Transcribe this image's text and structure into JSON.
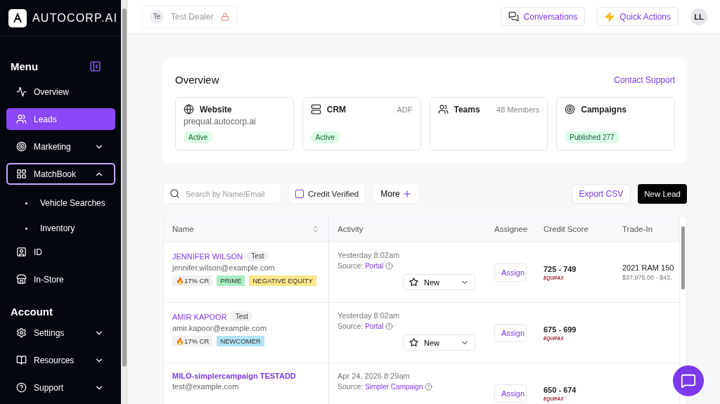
{
  "brand": {
    "name": "AUTOCORP.AI"
  },
  "sidebar": {
    "sections": [
      {
        "title": "Menu",
        "items": [
          {
            "label": "Overview",
            "selected": false,
            "focused": false
          },
          {
            "label": "Leads",
            "selected": true,
            "focused": false
          },
          {
            "label": "Marketing",
            "selected": false,
            "focused": false,
            "expanded": false
          },
          {
            "label": "MatchBook",
            "selected": false,
            "focused": true,
            "expanded": true,
            "children": [
              {
                "label": "Vehicle Searches"
              },
              {
                "label": "Inventory"
              }
            ]
          },
          {
            "label": "ID",
            "selected": false,
            "focused": false
          },
          {
            "label": "In-Store",
            "selected": false,
            "focused": false
          }
        ]
      },
      {
        "title": "Account",
        "items": [
          {
            "label": "Settings",
            "selected": false,
            "focused": false,
            "expanded": false
          },
          {
            "label": "Resources",
            "selected": false,
            "focused": false,
            "expanded": false
          },
          {
            "label": "Support",
            "selected": false,
            "focused": false,
            "expanded": false
          }
        ]
      }
    ]
  },
  "header": {
    "dealer_initials": "Te",
    "dealer": "Test Dealer",
    "locked": true,
    "buttons": [
      "Conversations",
      "Quick Actions"
    ],
    "user_initials": "LL"
  },
  "overview": {
    "title": "Overview",
    "link": "Contact Support",
    "cards": [
      {
        "title": "Website",
        "detail": "prequal.autocorp.ai",
        "badge": "Active"
      },
      {
        "title": "CRM",
        "meta": "ADF",
        "badge": "Active"
      },
      {
        "title": "Teams",
        "meta": "48 Members"
      },
      {
        "title": "Campaigns",
        "badge": "Published 277"
      }
    ]
  },
  "toolbar": {
    "search_placeholder": "Search by Name/Email",
    "credit_verified": {
      "label": "Credit Verified",
      "checked": false
    },
    "more": "More",
    "export": "Export CSV",
    "new_lead": "New Lead"
  },
  "table": {
    "columns": [
      "Name",
      "Activity",
      "Assignee",
      "Credit Score",
      "Trade-In"
    ],
    "rows": [
      {
        "name": "JENNIFER WILSON",
        "bold": false,
        "badge": "Test",
        "email": "jennifer.wilson@example.com",
        "tags": [
          {
            "label": "🔥17% CR",
            "color": "#f1f1f3"
          },
          {
            "label": "PRIME",
            "color": "#a7efc4"
          },
          {
            "label": "NEGATIVE EQUITY",
            "color": "#fde68a"
          }
        ],
        "time": "Yesterday 8:02am",
        "source_label": "Source:",
        "source": "Portal",
        "status": "New",
        "assign": "Assign",
        "score": "725 - 749",
        "bureau": "EQUIFAX",
        "trade_vehicle": "2021 RAM 150",
        "trade_value": "$37,975.00 - $43,"
      },
      {
        "name": "AMIR KAPOOR",
        "bold": false,
        "badge": "Test",
        "email": "amir.kapoor@example.com",
        "tags": [
          {
            "label": "🔥17% CR",
            "color": "#f1f1f3"
          },
          {
            "label": "NEWCOMER",
            "color": "#b3e3f7"
          }
        ],
        "time": "Yesterday 8:02am",
        "source_label": "Source:",
        "source": "Portal",
        "status": "New",
        "assign": "Assign",
        "score": "675 - 699",
        "bureau": "EQUIFAX"
      },
      {
        "name": "MILO-simplercampaign TESTADD",
        "bold": true,
        "email": "test@example.com",
        "time": "Apr 24, 2026 8:29am",
        "source_label": "Source:",
        "source": "Simpler Campaign",
        "assign": "Assign",
        "score": "650 - 674",
        "bureau": "EQUIFAX"
      }
    ]
  }
}
